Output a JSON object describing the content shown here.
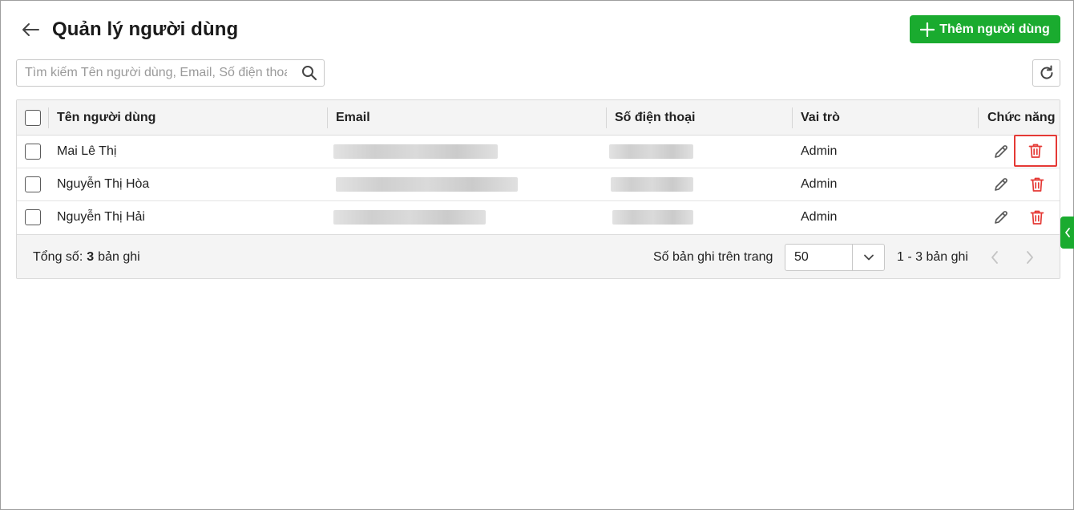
{
  "header": {
    "title": "Quản lý người dùng",
    "add_button_label": "Thêm người dùng"
  },
  "search": {
    "placeholder": "Tìm kiếm Tên người dùng, Email, Số điện thoại",
    "value": ""
  },
  "table": {
    "columns": {
      "name": "Tên người dùng",
      "email": "Email",
      "phone": "Số điện thoại",
      "role": "Vai trò",
      "actions": "Chức năng"
    },
    "rows": [
      {
        "name": "Mai Lê Thị",
        "email": "",
        "phone": "",
        "role": "Admin"
      },
      {
        "name": "Nguyễn Thị Hòa",
        "email": "",
        "phone": "",
        "role": "Admin"
      },
      {
        "name": "Nguyễn Thị Hải",
        "email": "",
        "phone": "",
        "role": "Admin"
      }
    ]
  },
  "footer": {
    "total_prefix": "Tổng số:",
    "total_count": "3",
    "total_suffix": "bản ghi",
    "per_page_label": "Số bản ghi trên trang",
    "per_page_value": "50",
    "range_text": "1 - 3 bản ghi"
  },
  "colors": {
    "accent": "#1aab2f",
    "danger": "#e53935",
    "icon_gray": "#555555",
    "disabled": "#c4c4c4"
  },
  "icons": {
    "back": "arrow-left-icon",
    "add": "plus-icon",
    "search": "search-icon",
    "refresh": "refresh-icon",
    "edit": "pencil-icon",
    "delete": "trash-icon",
    "dropdown": "chevron-down-icon",
    "prev": "chevron-left-icon",
    "next": "chevron-right-icon",
    "side_tab": "chevron-left-icon"
  }
}
